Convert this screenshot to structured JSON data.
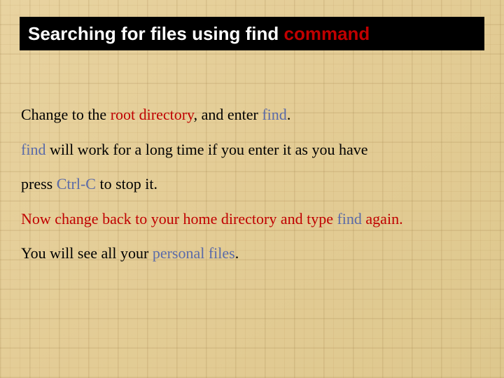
{
  "title": {
    "pre": "Searching for files using ",
    "find": "find ",
    "cmd": "command"
  },
  "p1": {
    "t1": "Change to the ",
    "root": "root directory",
    "t2": ", and enter ",
    "find": "find",
    "t3": "."
  },
  "p2": {
    "find": "find",
    "t1": " will work for a long time if you enter it as you have"
  },
  "p3": {
    "t1": "press ",
    "ctrl": "Ctrl-C",
    "t2": " to stop it."
  },
  "p4": {
    "t1": "Now change back to your home directory and type ",
    "find": "find",
    "t2": " again."
  },
  "p5": {
    "t1": "You will see all your ",
    "pf": "personal files",
    "t2": "."
  },
  "colors": {
    "accent": "#5a6aa8",
    "red": "#c00000",
    "titleBg": "#000000"
  }
}
